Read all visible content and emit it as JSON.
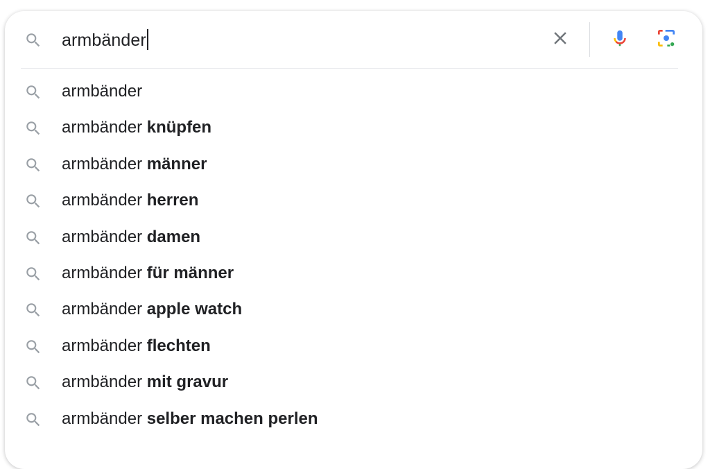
{
  "search": {
    "query": "armbänder"
  },
  "icons": {
    "search": "search-icon",
    "clear": "close-icon",
    "voice": "microphone-icon",
    "lens": "camera-lens-icon"
  },
  "colors": {
    "text": "#202124",
    "icon_gray": "#9aa0a6",
    "clear_gray": "#70757a",
    "google_blue": "#4285f4",
    "google_red": "#ea4335",
    "google_yellow": "#fbbc04",
    "google_green": "#34a853"
  },
  "suggestions": [
    {
      "prefix": "armbänder",
      "completion": ""
    },
    {
      "prefix": "armbänder ",
      "completion": "knüpfen"
    },
    {
      "prefix": "armbänder ",
      "completion": "männer"
    },
    {
      "prefix": "armbänder ",
      "completion": "herren"
    },
    {
      "prefix": "armbänder ",
      "completion": "damen"
    },
    {
      "prefix": "armbänder ",
      "completion": "für männer"
    },
    {
      "prefix": "armbänder ",
      "completion": "apple watch"
    },
    {
      "prefix": "armbänder ",
      "completion": "flechten"
    },
    {
      "prefix": "armbänder ",
      "completion": "mit gravur"
    },
    {
      "prefix": "armbänder ",
      "completion": "selber machen perlen"
    }
  ]
}
